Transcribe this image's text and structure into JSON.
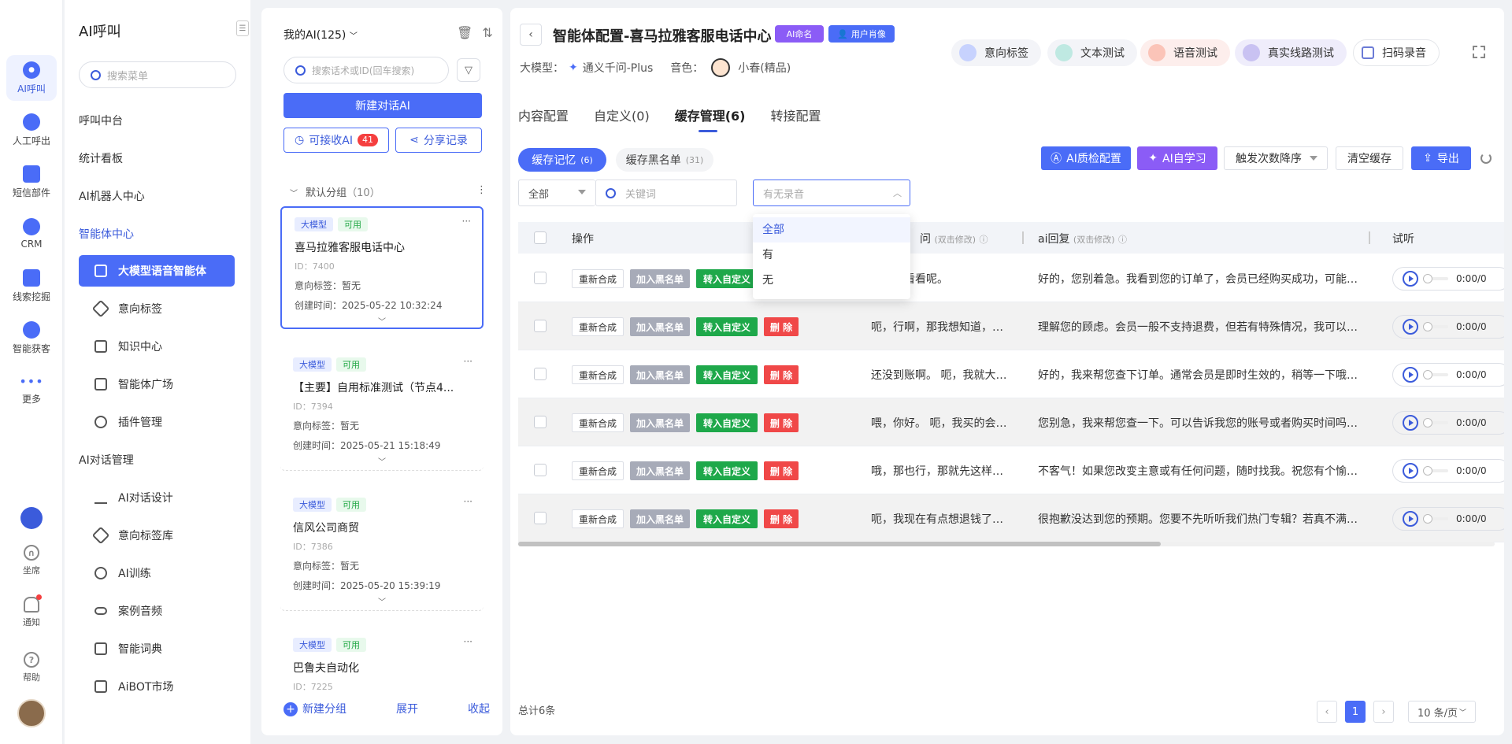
{
  "rail": {
    "items": [
      {
        "label": "AI呼叫",
        "active": true
      },
      {
        "label": "人工呼出"
      },
      {
        "label": "短信部件"
      },
      {
        "label": "CRM"
      },
      {
        "label": "线索挖掘"
      },
      {
        "label": "智能获客"
      },
      {
        "label": "更多"
      }
    ],
    "bottom": [
      {
        "label": "坐席"
      },
      {
        "label": "通知"
      },
      {
        "label": "帮助"
      }
    ]
  },
  "menu": {
    "title": "AI呼叫",
    "search_placeholder": "搜索菜单",
    "groups": {
      "call_center": "呼叫中台",
      "dashboard": "统计看板",
      "robot_center": "AI机器人中心",
      "agent_center": "智能体中心",
      "ai_dialog": "AI对话管理"
    },
    "items": {
      "llm_voice_agent": "大模型语音智能体",
      "intent_tag": "意向标签",
      "knowledge": "知识中心",
      "agent_plaza": "智能体广场",
      "plugin": "插件管理",
      "dialog_design": "AI对话设计",
      "intent_tag_lib": "意向标签库",
      "ai_training": "AI训练",
      "case_audio": "案例音频",
      "dictionary": "智能词典",
      "aibot_market": "AiBOT市场"
    }
  },
  "list_panel": {
    "header": "我的AI(125)",
    "search_placeholder": "搜索话术或ID(回车搜索)",
    "new_button": "新建对话AI",
    "receivable_label": "可接收AI",
    "receivable_count": "41",
    "share_label": "分享记录",
    "group_name": "默认分组",
    "group_count": "（10）",
    "cards": [
      {
        "tag1": "大模型",
        "tag2": "可用",
        "name": "喜马拉雅客服电话中心",
        "id": "ID：7400",
        "intent": "意向标签：暂无",
        "created": "创建时间：2025-05-22 10:32:24"
      },
      {
        "tag1": "大模型",
        "tag2": "可用",
        "name": "【主要】自用标准测试（节点4...",
        "id": "ID：7394",
        "intent": "意向标签：暂无",
        "created": "创建时间：2025-05-21 15:18:49"
      },
      {
        "tag1": "大模型",
        "tag2": "可用",
        "name": "信风公司商贸",
        "id": "ID：7386",
        "intent": "意向标签：暂无",
        "created": "创建时间：2025-05-20 15:39:19"
      },
      {
        "tag1": "大模型",
        "tag2": "可用",
        "name": "巴鲁夫自动化",
        "id": "ID：7225"
      }
    ],
    "footer": {
      "new_group": "新建分组",
      "expand": "展开",
      "collapse": "收起"
    }
  },
  "main": {
    "title": "智能体配置-喜马拉雅客服电话中心",
    "pill_ai_name": "AI命名",
    "pill_user_profile": "用户肖像",
    "model_label": "大模型：",
    "model_value": "通义千问-Plus",
    "voice_label": "音色：",
    "voice_value": "小春(精品)",
    "top_buttons": [
      "意向标签",
      "文本测试",
      "语音测试",
      "真实线路测试",
      "扫码录音"
    ],
    "tabs": [
      "内容配置",
      "自定义(0)",
      "缓存管理(6)",
      "转接配置"
    ],
    "active_tab": 2,
    "subtabs": [
      {
        "label": "缓存记忆",
        "count": "(6)"
      },
      {
        "label": "缓存黑名单",
        "count": "(31)"
      }
    ],
    "actions": {
      "qc": "AI质检配置",
      "learn": "AI自学习",
      "sort": "触发次数降序",
      "clear": "清空缓存",
      "export": "导出"
    },
    "filters": {
      "type_value": "全部",
      "keyword_placeholder": "关键词",
      "recording_placeholder": "有无录音"
    },
    "dropdown_options": [
      "全部",
      "有",
      "无"
    ],
    "table": {
      "headers": {
        "op": "操作",
        "q": "问",
        "q_hint": "(双击修改)",
        "a": "ai回复",
        "a_hint": "(双击修改)",
        "listen": "试听"
      },
      "row_buttons": {
        "resynth": "重新合成",
        "blacklist": "加入黑名单",
        "to_custom": "转入自定义",
        "delete": "删 除"
      },
      "rows": [
        {
          "q": "你帮我看看呢。",
          "a": "好的，您别着急。我看到您的订单了，会员已经购买成功，可能系...",
          "time": "0:00/0"
        },
        {
          "q": "呃，行啊，那我想知道，如...",
          "a": "理解您的顾虑。会员一般不支持退费，但若有特殊情况，我可以帮...",
          "time": "0:00/0"
        },
        {
          "q": "还没到账啊。 呃，我就大概...",
          "a": "好的，我来帮您查下订单。通常会员是即时生效的，稍等一下哦，...",
          "time": "0:00/0"
        },
        {
          "q": "喂，你好。 呃，我买的会员...",
          "a": "您别急，我来帮您查一下。可以告诉我您的账号或者购买时间吗？...",
          "time": "0:00/0"
        },
        {
          "q": "哦，那也行，那就先这样吧...",
          "a": "不客气！如果您改变主意或有任何问题，随时找我。祝您有个愉快...",
          "time": "0:00/0"
        },
        {
          "q": "呃，我现在有点想退钱了，...",
          "a": "很抱歉没达到您的预期。您要不先听听我们热门专辑？若真不满意...",
          "time": "0:00/0"
        }
      ]
    },
    "total": "总计6条",
    "pagination": {
      "current": "1",
      "page_size": "10 条/页"
    }
  }
}
